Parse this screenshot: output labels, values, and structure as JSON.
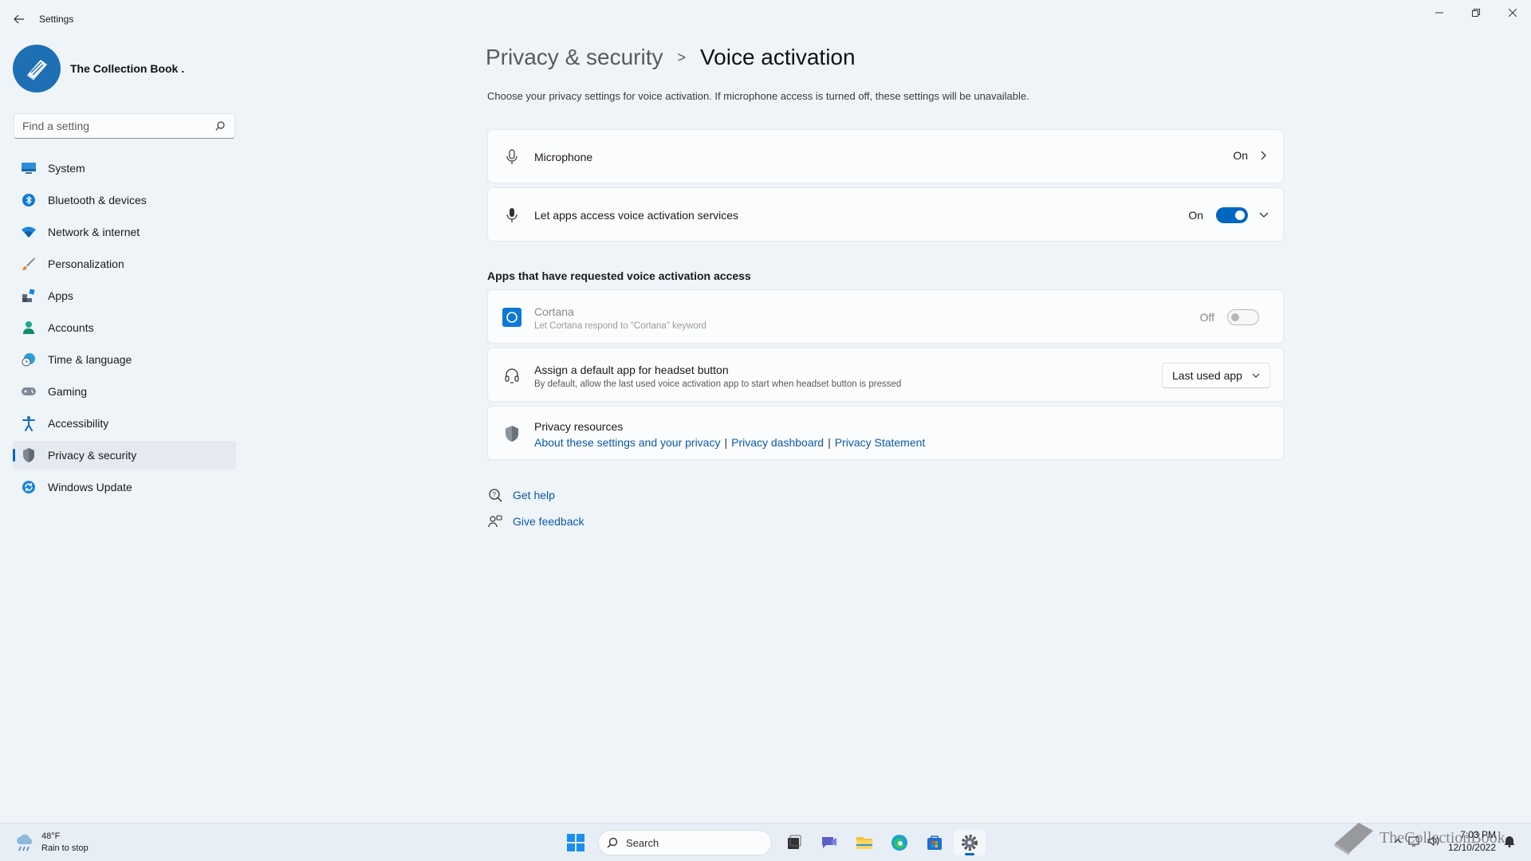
{
  "window": {
    "title": "Settings"
  },
  "profile": {
    "name": "The Collection Book ."
  },
  "search": {
    "placeholder": "Find a setting"
  },
  "sidebar": {
    "items": [
      {
        "label": "System",
        "icon": "monitor-icon"
      },
      {
        "label": "Bluetooth & devices",
        "icon": "bluetooth-icon"
      },
      {
        "label": "Network & internet",
        "icon": "wifi-icon"
      },
      {
        "label": "Personalization",
        "icon": "brush-icon"
      },
      {
        "label": "Apps",
        "icon": "apps-icon"
      },
      {
        "label": "Accounts",
        "icon": "person-icon"
      },
      {
        "label": "Time & language",
        "icon": "globe-clock-icon"
      },
      {
        "label": "Gaming",
        "icon": "gamepad-icon"
      },
      {
        "label": "Accessibility",
        "icon": "accessibility-icon"
      },
      {
        "label": "Privacy & security",
        "icon": "shield-icon"
      },
      {
        "label": "Windows Update",
        "icon": "update-icon"
      }
    ],
    "active": "Privacy & security"
  },
  "breadcrumb": {
    "parent": "Privacy & security",
    "separator": ">",
    "current": "Voice activation"
  },
  "description": "Choose your privacy settings for voice activation. If microphone access is turned off, these settings will be unavailable.",
  "microphone": {
    "label": "Microphone",
    "status": "On"
  },
  "voice_services": {
    "label": "Let apps access voice activation services",
    "status": "On",
    "toggle": "on"
  },
  "apps_section": {
    "title": "Apps that have requested voice activation access"
  },
  "cortana": {
    "label": "Cortana",
    "sub": "Let Cortana respond to \"Cortana\" keyword",
    "status": "Off",
    "toggle": "off"
  },
  "headset": {
    "label": "Assign a default app for headset button",
    "sub": "By default, allow the last used voice activation app to start when headset button is pressed",
    "selected": "Last used app"
  },
  "privacy_resources": {
    "label": "Privacy resources",
    "links": [
      "About these settings and your privacy",
      "Privacy dashboard",
      "Privacy Statement"
    ],
    "separator": "|"
  },
  "help": {
    "get_help": "Get help",
    "give_feedback": "Give feedback"
  },
  "taskbar": {
    "weather_temp": "48°F",
    "weather_desc": "Rain to stop",
    "search_label": "Search",
    "time": "7:03 PM",
    "date": "12/10/2022"
  },
  "watermark": "TheCollectionBook",
  "colors": {
    "accent": "#0067c0",
    "link": "#0a5aa8",
    "background": "#eff4f9"
  }
}
